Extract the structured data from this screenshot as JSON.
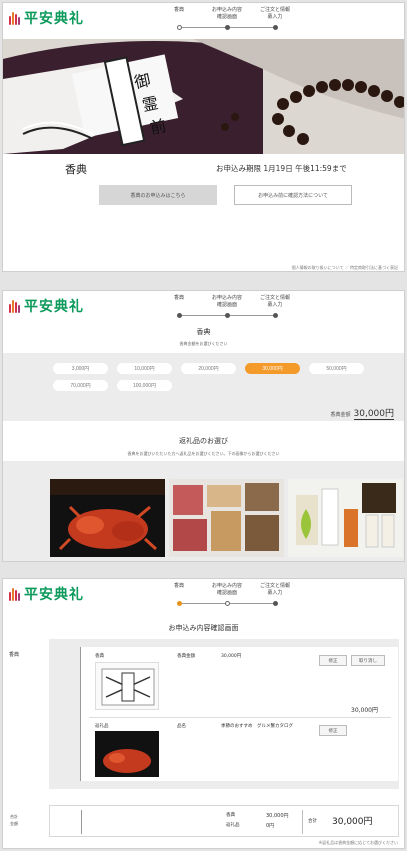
{
  "brand": {
    "name": "平安典礼",
    "color": "#0c9a5c"
  },
  "steps": [
    {
      "label": "香典"
    },
    {
      "label": "お申込み内容\n確認画面"
    },
    {
      "label": "ご注文と情報\n募入力"
    }
  ],
  "panel1": {
    "title": "香典",
    "deadline": "お申込み期限 1月19日 午後11:59まで",
    "btn_primary": "香典のお申込みはこちら",
    "btn_secondary": "お申込み前に確認方法について",
    "footer": "個人情報の取り扱いについて ／ 特定商取引法に基づく表記"
  },
  "panel2": {
    "title": "香典",
    "subtitle": "香典金額をお選びください",
    "amounts": [
      "3,000円",
      "10,000円",
      "20,000円",
      "30,000円",
      "50,000円",
      "70,000円",
      "100,000円"
    ],
    "selected_amount": "30,000円",
    "total_label": "香典金額",
    "total_value": "30,000円",
    "gifts_title": "返礼品のお選び",
    "gifts_sub": "香典をお選びいただいた方へ返礼品をお選びください。下の画像からお選びください"
  },
  "panel3": {
    "title": "お申込み内容確認画面",
    "koden_label": "香典",
    "item1": {
      "name": "香典",
      "amount_label": "香典金額",
      "amount": "30,000円",
      "edit": "修正",
      "delete": "取り消し"
    },
    "item2": {
      "name": "返礼品",
      "label": "品名",
      "desc": "季節のおすすめ　グルメ蟹カタログ",
      "edit": "修正"
    },
    "sub_value": "30,000円",
    "sum_label": "合計\n金額",
    "summary_label1": "香典",
    "summary_value1": "30,000円",
    "summary_label2": "返礼品",
    "summary_value2": "0円",
    "grand_label": "合計",
    "grand_total": "30,000円",
    "footer": "※返礼品は香典金額に応じてお選びください"
  }
}
